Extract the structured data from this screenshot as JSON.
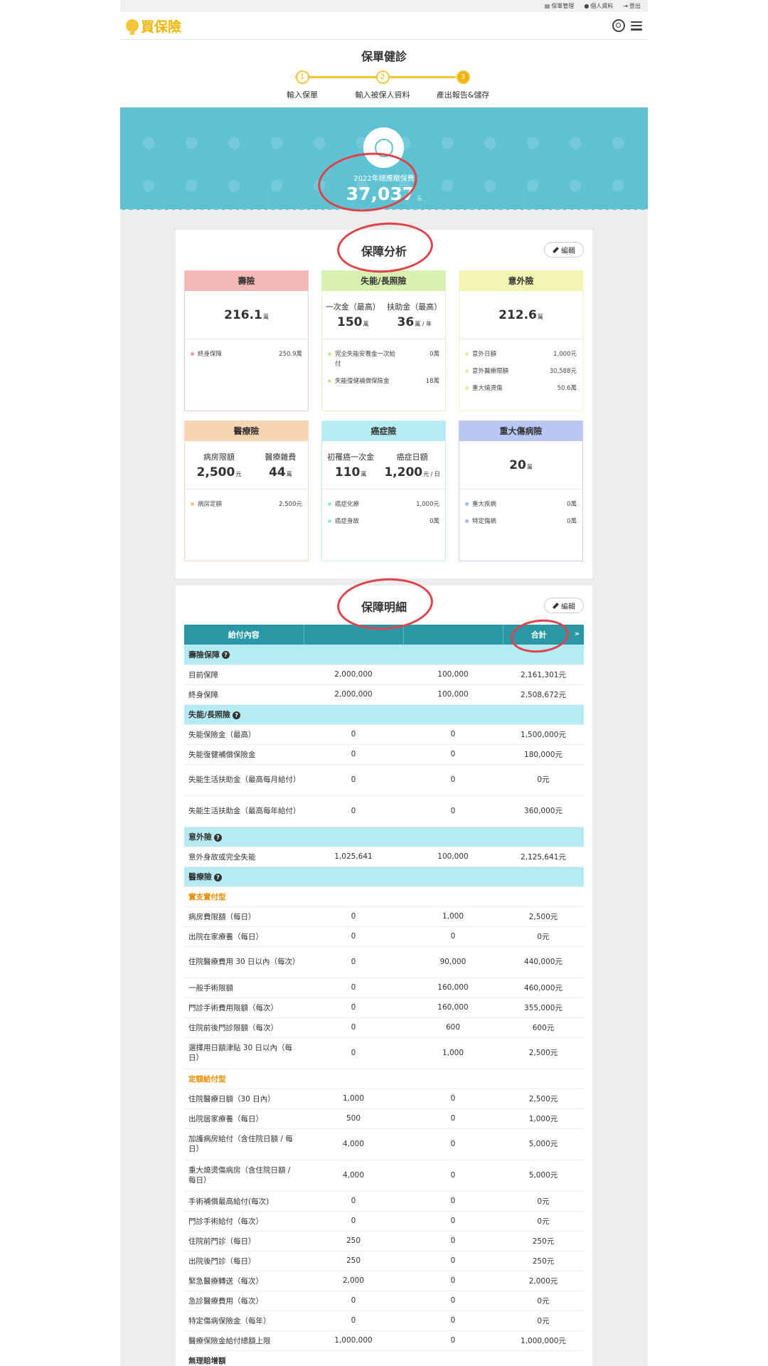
{
  "topbar": {
    "links": [
      {
        "icon": "document-icon",
        "label": "保單管理"
      },
      {
        "icon": "user-icon",
        "label": "個人資料"
      },
      {
        "icon": "logout-icon",
        "label": "登出"
      }
    ]
  },
  "nav": {
    "logo": "買保險"
  },
  "stepper": {
    "title": "保單健診",
    "steps": [
      {
        "num": "1",
        "label": "輸入保單"
      },
      {
        "num": "2",
        "label": "輸入被保人資料"
      },
      {
        "num": "3",
        "label": "產出報告&儲存"
      }
    ]
  },
  "banner": {
    "label": "2022年總應繳保費",
    "amount": "37,037",
    "unit": "元"
  },
  "analysis": {
    "title": "保障分析",
    "edit_label": "編輯",
    "boxes": [
      {
        "title": "壽險",
        "color": "#f5b8b8",
        "border": "#f0c6c6",
        "dot": "#f19c9c",
        "metrics": [
          {
            "label": "",
            "value": "216.1",
            "unit": "萬"
          }
        ],
        "items": [
          {
            "name": "終身保障",
            "value": "250.9萬"
          }
        ]
      },
      {
        "title": "失能/長照險",
        "color": "#d7f2b0",
        "border": "#dff2c6",
        "dot": "#c7e98f",
        "metrics": [
          {
            "label": "一次金（最高）",
            "value": "150",
            "unit": "萬"
          },
          {
            "label": "扶助金（最高）",
            "value": "36",
            "unit": "萬 / 年"
          }
        ],
        "items": [
          {
            "name": "完全失能安養金一次給付",
            "value": "0萬"
          },
          {
            "name": "失能復健補償保險金",
            "value": "18萬"
          }
        ]
      },
      {
        "title": "意外險",
        "color": "#f2f4b2",
        "border": "#eff2c6",
        "dot": "#e8ec9c",
        "metrics": [
          {
            "label": "",
            "value": "212.6",
            "unit": "萬"
          }
        ],
        "items": [
          {
            "name": "意外日額",
            "value": "1,000元"
          },
          {
            "name": "意外醫療限額",
            "value": "30,588元"
          },
          {
            "name": "重大燒燙傷",
            "value": "50.6萬"
          }
        ]
      },
      {
        "title": "醫療險",
        "color": "#f7d4b4",
        "border": "#f3dcc6",
        "dot": "#f4c39a",
        "metrics": [
          {
            "label": "病房限額",
            "value": "2,500",
            "unit": "元"
          },
          {
            "label": "醫療雜費",
            "value": "44",
            "unit": "萬"
          }
        ],
        "items": [
          {
            "name": "病房定額",
            "value": "2,500元"
          }
        ]
      },
      {
        "title": "癌症險",
        "color": "#b5ecf3",
        "border": "#c6eef3",
        "dot": "#9fe0ea",
        "metrics": [
          {
            "label": "初罹癌一次金",
            "value": "110",
            "unit": "萬"
          },
          {
            "label": "癌症日額",
            "value": "1,200",
            "unit": "元 / 日"
          }
        ],
        "items": [
          {
            "name": "癌症化療",
            "value": "1,000元"
          },
          {
            "name": "癌症身故",
            "value": "0萬"
          }
        ]
      },
      {
        "title": "重大傷病險",
        "color": "#b8c8f3",
        "border": "#c6d0f0",
        "dot": "#a6b9ee",
        "metrics": [
          {
            "label": "",
            "value": "20",
            "unit": "萬"
          }
        ],
        "items": [
          {
            "name": "重大疾病",
            "value": "0萬"
          },
          {
            "name": "特定傷病",
            "value": "0萬"
          }
        ]
      }
    ]
  },
  "detail": {
    "title": "保障明細",
    "edit_label": "編輯",
    "headers": [
      "給付內容",
      "",
      "",
      "合計"
    ],
    "rows": [
      {
        "type": "sect",
        "label": "壽險保障"
      },
      {
        "type": "row",
        "label": "目前保障",
        "a": "2,000,000",
        "b": "100,000",
        "total": "2,161,301元"
      },
      {
        "type": "row",
        "label": "終身保障",
        "a": "2,000,000",
        "b": "100,000",
        "total": "2,508,672元"
      },
      {
        "type": "sect",
        "label": "失能/長照險"
      },
      {
        "type": "row",
        "label": "失能保險金（最高）",
        "a": "0",
        "b": "0",
        "total": "1,500,000元"
      },
      {
        "type": "row",
        "label": "失能復健補償保險金",
        "a": "0",
        "b": "0",
        "total": "180,000元"
      },
      {
        "type": "tall",
        "label": "失能生活扶助金（最高每月給付）",
        "a": "0",
        "b": "0",
        "total": "0元"
      },
      {
        "type": "tall",
        "label": "失能生活扶助金（最高每年給付）",
        "a": "0",
        "b": "0",
        "total": "360,000元"
      },
      {
        "type": "sect",
        "label": "意外險"
      },
      {
        "type": "row",
        "label": "意外身故或完全失能",
        "a": "1,025,641",
        "b": "100,000",
        "total": "2,125,641元"
      },
      {
        "type": "sect",
        "label": "醫療險"
      },
      {
        "type": "sub",
        "label": "實支實付型"
      },
      {
        "type": "row",
        "label": "病房費限額（每日）",
        "a": "0",
        "b": "1,000",
        "total": "2,500元"
      },
      {
        "type": "row",
        "label": "出院在家療養（每日）",
        "a": "0",
        "b": "0",
        "total": "0元"
      },
      {
        "type": "tall",
        "label": "住院醫療費用 30 日以內（每次）",
        "a": "0",
        "b": "90,000",
        "total": "440,000元"
      },
      {
        "type": "row",
        "label": "一般手術限額",
        "a": "0",
        "b": "160,000",
        "total": "460,000元"
      },
      {
        "type": "row",
        "label": "門診手術費用限額（每次）",
        "a": "0",
        "b": "160,000",
        "total": "355,000元"
      },
      {
        "type": "row",
        "label": "住院前後門診限額（每次）",
        "a": "0",
        "b": "600",
        "total": "600元"
      },
      {
        "type": "tall",
        "label": "選擇用日額津貼 30 日以內（每日）",
        "a": "0",
        "b": "1,000",
        "total": "2,500元"
      },
      {
        "type": "sub",
        "label": "定額給付型"
      },
      {
        "type": "row",
        "label": "住院醫療日額（30 日內）",
        "a": "1,000",
        "b": "0",
        "total": "2,500元"
      },
      {
        "type": "row",
        "label": "出院居家療養（每日）",
        "a": "500",
        "b": "0",
        "total": "1,000元"
      },
      {
        "type": "tall",
        "label": "加護病房給付（含住院日額 / 每日）",
        "a": "4,000",
        "b": "0",
        "total": "5,000元"
      },
      {
        "type": "tall",
        "label": "重大燒燙傷病房（含住院日額 / 每日）",
        "a": "4,000",
        "b": "0",
        "total": "5,000元"
      },
      {
        "type": "row",
        "label": "手術補償最高給付(每次)",
        "a": "0",
        "b": "0",
        "total": "0元"
      },
      {
        "type": "row",
        "label": "門診手術給付（每次）",
        "a": "0",
        "b": "0",
        "total": "0元"
      },
      {
        "type": "row",
        "label": "住院前門診（每日）",
        "a": "250",
        "b": "0",
        "total": "250元"
      },
      {
        "type": "row",
        "label": "出院後門診（每日）",
        "a": "250",
        "b": "0",
        "total": "250元"
      },
      {
        "type": "row",
        "label": "緊急醫療轉送（每次）",
        "a": "2,000",
        "b": "0",
        "total": "2,000元"
      },
      {
        "type": "row",
        "label": "急診醫療費用（每次）",
        "a": "0",
        "b": "0",
        "total": "0元"
      },
      {
        "type": "row",
        "label": "特定傷病保險金（每年）",
        "a": "0",
        "b": "0",
        "total": "0元"
      },
      {
        "type": "row",
        "label": "醫療保險金給付總額上限",
        "a": "1,000,000",
        "b": "0",
        "total": "1,000,000元"
      },
      {
        "type": "plain",
        "label": "無理賠增額"
      }
    ]
  },
  "colors": {
    "accent": "#f0b400",
    "teal": "#2a97a6",
    "banner": "#5ec2d3",
    "annotation": "#e0424a"
  }
}
